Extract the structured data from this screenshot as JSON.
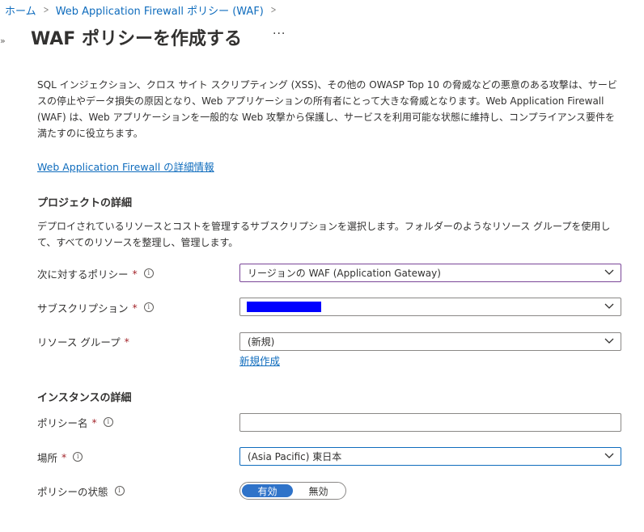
{
  "breadcrumb": {
    "home": "ホーム",
    "waf": "Web Application Firewall ポリシー (WAF)"
  },
  "header": {
    "title": "WAF ポリシーを作成する",
    "more": "···"
  },
  "intro": {
    "description": "SQL インジェクション、クロス サイト スクリプティング (XSS)、その他の OWASP Top 10 の脅威などの悪意のある攻撃は、サービスの停止やデータ損失の原因となり、Web アプリケーションの所有者にとって大きな脅威となります。Web Application Firewall (WAF) は、Web アプリケーションを一般的な Web 攻撃から保護し、サービスを利用可能な状態に維持し、コンプライアンス要件を満たすのに役立ちます。",
    "learn_more": "Web Application Firewall の詳細情報"
  },
  "project": {
    "title": "プロジェクトの詳細",
    "description": "デプロイされているリソースとコストを管理するサブスクリプションを選択します。フォルダーのようなリソース グループを使用して、すべてのリソースを整理し、管理します。",
    "policy_for_label": "次に対するポリシー",
    "policy_for_value": "リージョンの WAF (Application Gateway)",
    "subscription_label": "サブスクリプション",
    "resource_group_label": "リソース グループ",
    "resource_group_value": "(新規)",
    "create_new": "新規作成"
  },
  "instance": {
    "title": "インスタンスの詳細",
    "policy_name_label": "ポリシー名",
    "policy_name_value": "",
    "location_label": "場所",
    "location_value": "(Asia Pacific) 東日本",
    "policy_state_label": "ポリシーの状態",
    "state_enabled": "有効",
    "state_disabled": "無効"
  },
  "common": {
    "required_mark": "*",
    "info_glyph": "i",
    "breadcrumb_sep": ">",
    "expand_glyph": "»"
  },
  "colors": {
    "link": "#0f6cbd",
    "required": "#a4262c",
    "toggle_on": "#2f73c9",
    "focus_border": "#7a4598",
    "redaction": "#0000ff"
  }
}
